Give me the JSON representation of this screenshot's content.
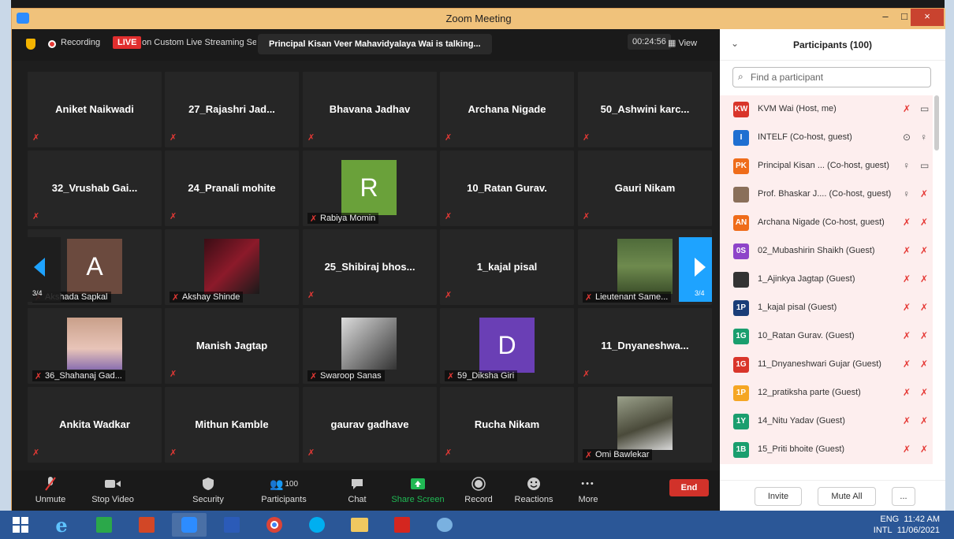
{
  "window": {
    "title": "Zoom Meeting"
  },
  "topbar": {
    "recording": "Recording",
    "live": "LIVE",
    "stream": "on Custom Live Streaming Serv",
    "talking": "Principal Kisan Veer Mahavidyalaya Wai is talking...",
    "timer": "00:24:56",
    "view": "View"
  },
  "tiles": [
    {
      "name": "Aniket Naikwadi"
    },
    {
      "name": "27_Rajashri Jad..."
    },
    {
      "name": "Bhavana Jadhav"
    },
    {
      "name": "Archana Nigade"
    },
    {
      "name": "50_Ashwini karc..."
    },
    {
      "name": "32_Vrushab Gai..."
    },
    {
      "name": "24_Pranali mohite"
    },
    {
      "name": "Rabiya Momin",
      "initial": "R"
    },
    {
      "name": "10_Ratan Gurav."
    },
    {
      "name": "Gauri Nikam"
    },
    {
      "name": "Akshada Sapkal",
      "initial": "A"
    },
    {
      "name": "Akshay Shinde"
    },
    {
      "name": "25_Shibiraj bhos..."
    },
    {
      "name": "1_kajal pisal"
    },
    {
      "name": "Lieutenant Same..."
    },
    {
      "name": "36_Shahanaj Gad..."
    },
    {
      "name": "Manish Jagtap"
    },
    {
      "name": "Swaroop Sanas"
    },
    {
      "name": "59_Diksha Giri",
      "initial": "D"
    },
    {
      "name": "11_Dnyaneshwa..."
    },
    {
      "name": "Ankita Wadkar"
    },
    {
      "name": "Mithun Kamble"
    },
    {
      "name": "gaurav gadhave"
    },
    {
      "name": "Rucha Nikam"
    },
    {
      "name": "Omi Bawlekar"
    }
  ],
  "nav": {
    "page": "3/4"
  },
  "toolbar": {
    "unmute": "Unmute",
    "stop_video": "Stop Video",
    "security": "Security",
    "participants": "Participants",
    "participants_count": "100",
    "chat": "Chat",
    "share": "Share Screen",
    "record": "Record",
    "reactions": "Reactions",
    "more": "More",
    "end": "End"
  },
  "panel": {
    "title": "Participants (100)",
    "search_placeholder": "Find a participant",
    "participants": [
      {
        "initials": "KW",
        "color": "#d9352a",
        "name": "KVM Wai (Host, me)"
      },
      {
        "initials": "I",
        "color": "#1f6fd1",
        "name": "INTELF (Co-host, guest)"
      },
      {
        "initials": "PK",
        "color": "#ef6c1a",
        "name": "Principal Kisan ... (Co-host, guest)"
      },
      {
        "initials": "",
        "color": "#8a6f5a",
        "name": "Prof. Bhaskar J.... (Co-host, guest)"
      },
      {
        "initials": "AN",
        "color": "#ef6c1a",
        "name": "Archana Nigade (Co-host, guest)"
      },
      {
        "initials": "0S",
        "color": "#8e44c9",
        "name": "02_Mubashirin Shaikh (Guest)"
      },
      {
        "initials": "",
        "color": "#333333",
        "name": "1_Ajinkya Jagtap (Guest)"
      },
      {
        "initials": "1P",
        "color": "#1a3d78",
        "name": "1_kajal pisal (Guest)"
      },
      {
        "initials": "1G",
        "color": "#1a9e6e",
        "name": "10_Ratan Gurav. (Guest)"
      },
      {
        "initials": "1G",
        "color": "#d9352a",
        "name": "11_Dnyaneshwari Gujar (Guest)"
      },
      {
        "initials": "1P",
        "color": "#f5a623",
        "name": "12_pratiksha parte (Guest)"
      },
      {
        "initials": "1Y",
        "color": "#1a9e6e",
        "name": "14_Nitu Yadav (Guest)"
      },
      {
        "initials": "1B",
        "color": "#1a9e6e",
        "name": "15_Priti bhoite (Guest)"
      }
    ],
    "invite": "Invite",
    "mute_all": "Mute All",
    "more": "..."
  },
  "tray": {
    "lang": "ENG",
    "kb": "INTL",
    "time": "11:42 AM",
    "date": "11/06/2021"
  }
}
